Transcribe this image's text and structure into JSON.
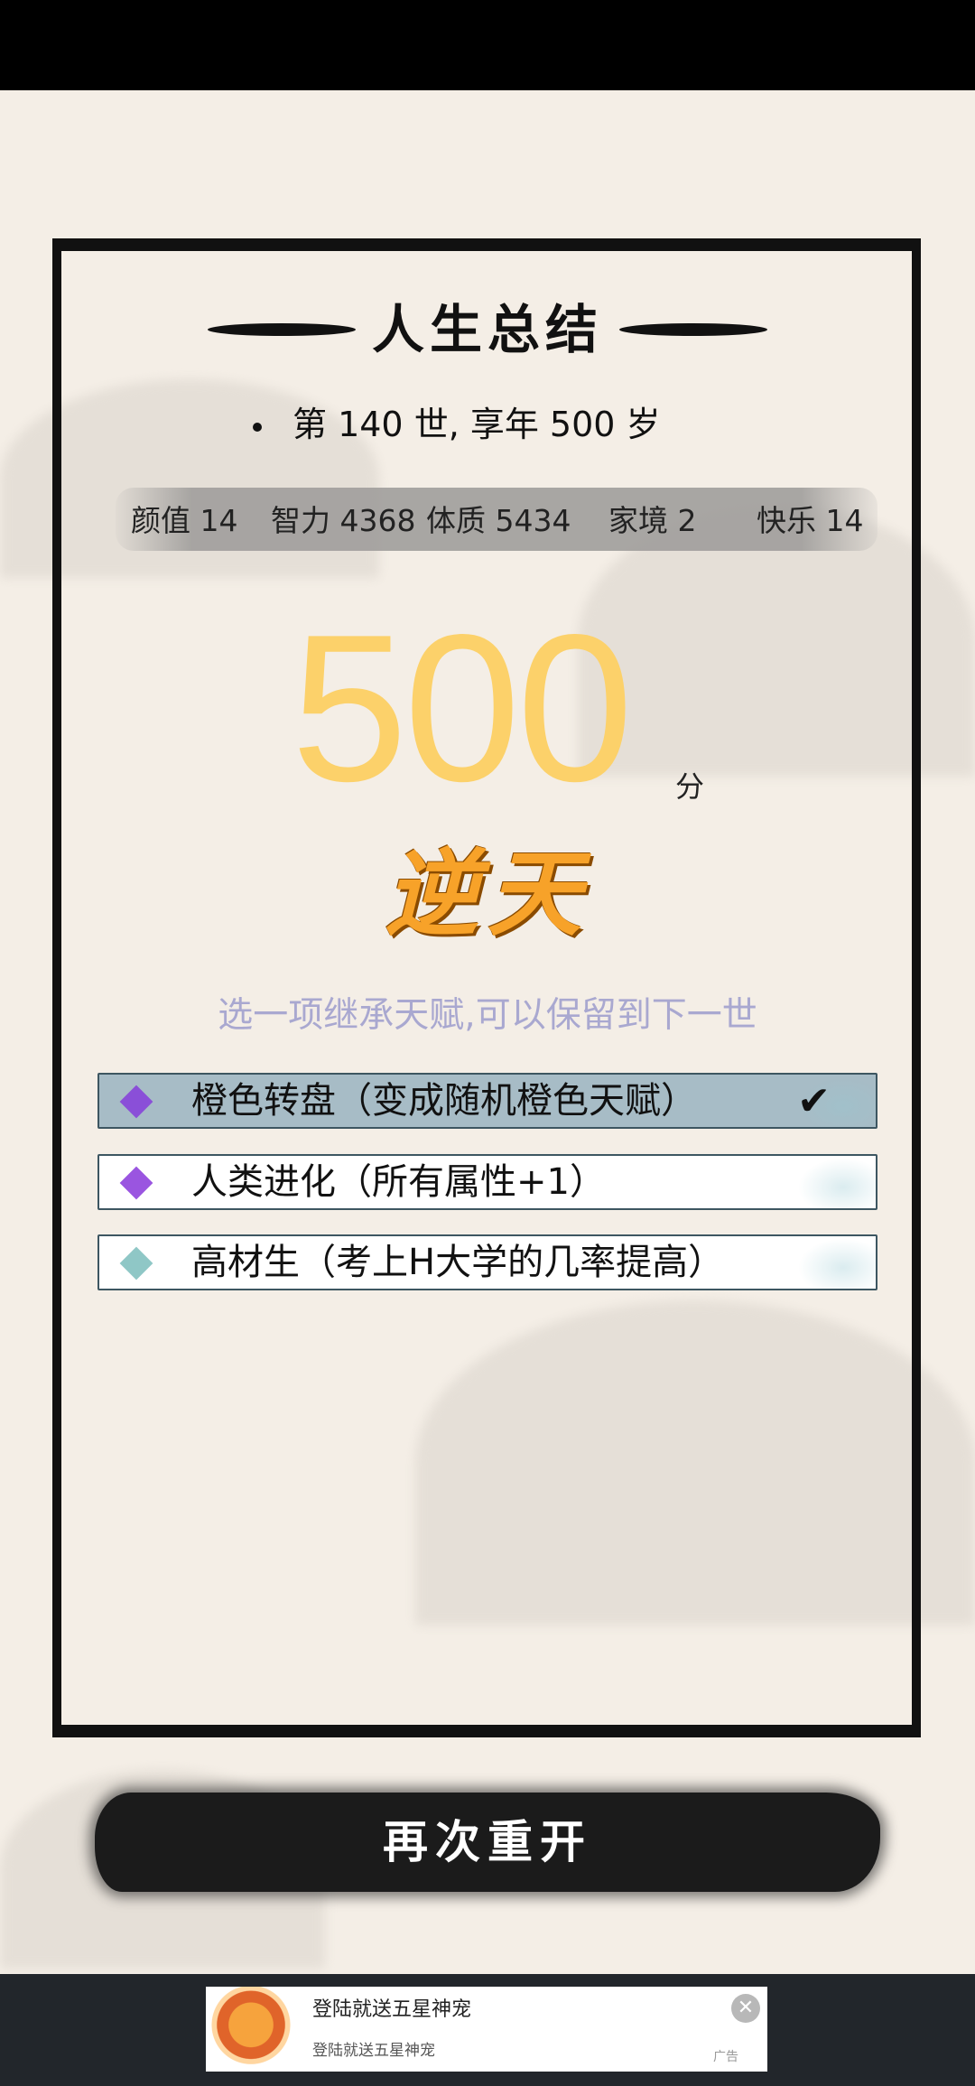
{
  "summary": {
    "title": "人生总结",
    "life_line": "第 140 世, 享年 500 岁"
  },
  "attributes": [
    {
      "name": "颜值",
      "value": "14",
      "text": "颜值 14"
    },
    {
      "name": "智力",
      "value": "4368",
      "text": "智力 4368"
    },
    {
      "name": "体质",
      "value": "5434",
      "text": "体质 5434"
    },
    {
      "name": "家境",
      "value": "2",
      "text": "家境 2"
    },
    {
      "name": "快乐",
      "value": "14",
      "text": "快乐 14"
    }
  ],
  "score": {
    "value": "500",
    "unit": "分",
    "rank": "逆天",
    "score_color": "#fcd16a",
    "rank_color": "#f7a229"
  },
  "inherit": {
    "hint": "选一项继承天赋,可以保留到下一世"
  },
  "talents": [
    {
      "label": "橙色转盘（变成随机橙色天赋）",
      "icon": "purple-diamond-icon",
      "color": "#8a4fd8",
      "selected": true,
      "check": "✔"
    },
    {
      "label": "人类进化（所有属性+1）",
      "icon": "purple-diamond-icon",
      "color": "#9a55e0",
      "selected": false
    },
    {
      "label": "高材生（考上H大学的几率提高）",
      "icon": "teal-diamond-icon",
      "color": "#8fc7c6",
      "selected": false
    }
  ],
  "actions": {
    "restart_label": "再次重开"
  },
  "ad": {
    "title": "登陆就送五星神宠",
    "subtitle": "登陆就送五星神宠",
    "close": "✕",
    "tag": "广告"
  }
}
